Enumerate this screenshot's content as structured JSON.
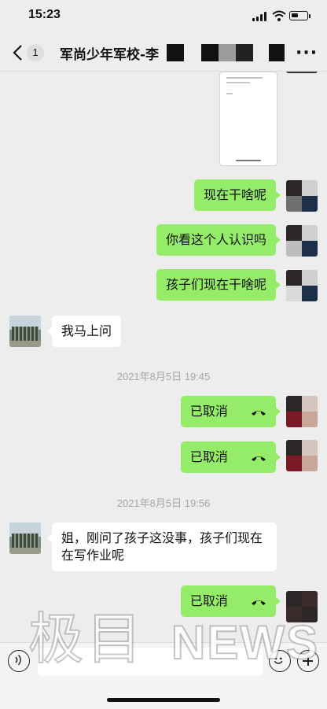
{
  "status_bar": {
    "time": "15:23"
  },
  "nav": {
    "back_count": "1",
    "title": "军尚少年军校-李"
  },
  "messages": [
    {
      "id": "m1",
      "dir": "out",
      "text": "现在干啥呢"
    },
    {
      "id": "m2",
      "dir": "out",
      "text": "你看这个人认识吗"
    },
    {
      "id": "m3",
      "dir": "out",
      "text": "孩子们现在干啥呢"
    },
    {
      "id": "m4",
      "dir": "in",
      "text": "我马上问"
    },
    {
      "id": "t1",
      "type": "timestamp",
      "text": "2021年8月5日 19:45"
    },
    {
      "id": "m5",
      "dir": "out",
      "text": "已取消",
      "call": true
    },
    {
      "id": "m6",
      "dir": "out",
      "text": "已取消",
      "call": true
    },
    {
      "id": "t2",
      "type": "timestamp",
      "text": "2021年8月5日 19:56"
    },
    {
      "id": "m7",
      "dir": "in",
      "text": "姐，刚问了孩子这没事，孩子们现在在写作业呢"
    },
    {
      "id": "m8",
      "dir": "out",
      "text": "已取消",
      "call": true
    }
  ],
  "watermark": {
    "cn": "极目",
    "en": "NEWS"
  },
  "icons": {
    "back": "chevron-left-icon",
    "more": "more-dots-icon",
    "voice": "voice-icon",
    "emoji": "emoji-icon",
    "plus": "plus-icon",
    "call": "phone-hangup-icon"
  },
  "colors": {
    "out_bubble": "#95ec69",
    "in_bubble": "#ffffff",
    "background": "#ededed",
    "timestamp": "#a6a6a6"
  }
}
